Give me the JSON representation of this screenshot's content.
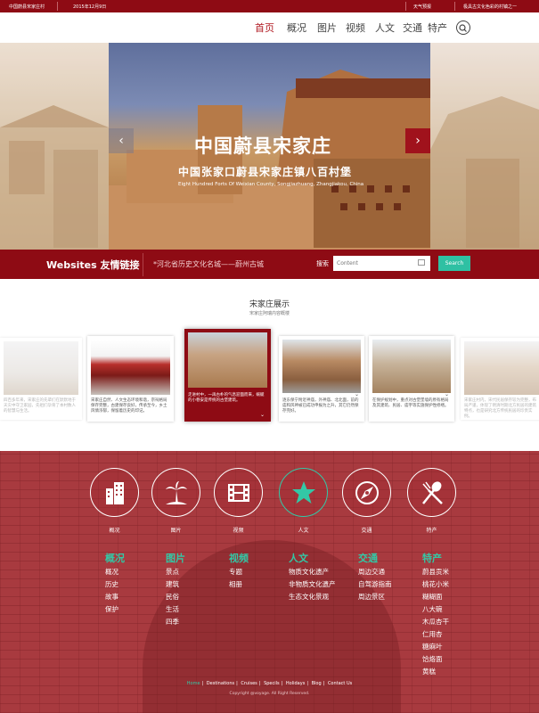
{
  "topbar": {
    "site": "中国蔚县宋家庄村",
    "date": "2015年12月9日",
    "weather": "天气预报",
    "slogan": "极具古文化色彩的村镇之一"
  },
  "nav": {
    "items": [
      "首页",
      "概况",
      "图片",
      "视频",
      "人文",
      "交通",
      "特产"
    ],
    "active": "首页"
  },
  "hero": {
    "title": "中国蔚县宋家庄",
    "subtitle": "中国张家口蔚县宋家庄镇八百村堡",
    "subtitle_en": "Eight Hundred Forts Of Weixian County, Songjiazhuang, Zhangjiakou, China",
    "prev": "‹",
    "next": "›"
  },
  "linkbar": {
    "label": "Websites  友情链接",
    "link": "*河北省历史文化名城——蔚州古城",
    "search_label": "搜索",
    "search_placeholder": "Content",
    "search_button": "Search"
  },
  "showcase": {
    "title": "宋家庄展示",
    "subtitle": "宋家庄阿瑞内容概楼",
    "cards": [
      {
        "caption": "四百多年来，宋家庄的先辈们在默默地于天灾中守卫家园，先祖们孕育了本村数人的智慧与生活。"
      },
      {
        "caption": "宋家庄自然、人文生态环境和谐，宗祠格局保存完整，古建保存良好，传承至今，乡土风情浓郁，保留着历史的印记。"
      },
      {
        "caption": "走进村中，一再古朴的气息迎面而来，蜿蜒的小巷安是传统的古堡建筑。"
      },
      {
        "caption": "逐东保宁附近神庙，外神庙、北北面，前的庙和风神被已成功申报为之升，其它仍然保存完好。"
      },
      {
        "caption": "在保护规划中，重点对古堡堡墙的原有格局及其建筑、民居、庙宇等实施保护性修缮。"
      },
      {
        "caption": "宋家庄村内，宋代民居保存较为完整，布局严谨，体现了明清时期北方民居的建筑特点，也是研究北方传统民居的珍贵实例。"
      }
    ]
  },
  "footer": {
    "circles": [
      "概况",
      "图片",
      "视频",
      "人文",
      "交通",
      "特产"
    ],
    "columns": [
      {
        "head": "概况",
        "links": [
          "概况",
          "历史",
          "故事",
          "保护"
        ]
      },
      {
        "head": "图片",
        "links": [
          "景点",
          "建筑",
          "民俗",
          "生活",
          "四季"
        ]
      },
      {
        "head": "视频",
        "links": [
          "专题",
          "相册"
        ]
      },
      {
        "head": "人文",
        "links": [
          "物质文化遗产",
          "非物质文化遗产",
          "生态文化景观"
        ]
      },
      {
        "head": "交通",
        "links": [
          "周边交通",
          "自驾游指南",
          "周边景区"
        ]
      },
      {
        "head": "特产",
        "links": [
          "蔚县贡米",
          "桃花小米",
          "糊糊面",
          "八大碗",
          "木瓜杏干",
          "仁用杏",
          "糖麻叶",
          "饸烙面",
          "黄糕"
        ]
      }
    ],
    "bottom_links": [
      "Home",
      "Destinations",
      "Cruises",
      "Specils",
      "Holidays",
      "Blog",
      "Contact Us"
    ],
    "copyright": "Copyright @voyage. All Right Reserved.",
    "accent": "#33c8a6"
  },
  "colors": {
    "brand_red": "#8e0b14",
    "accent_teal": "#2fc0a3"
  }
}
